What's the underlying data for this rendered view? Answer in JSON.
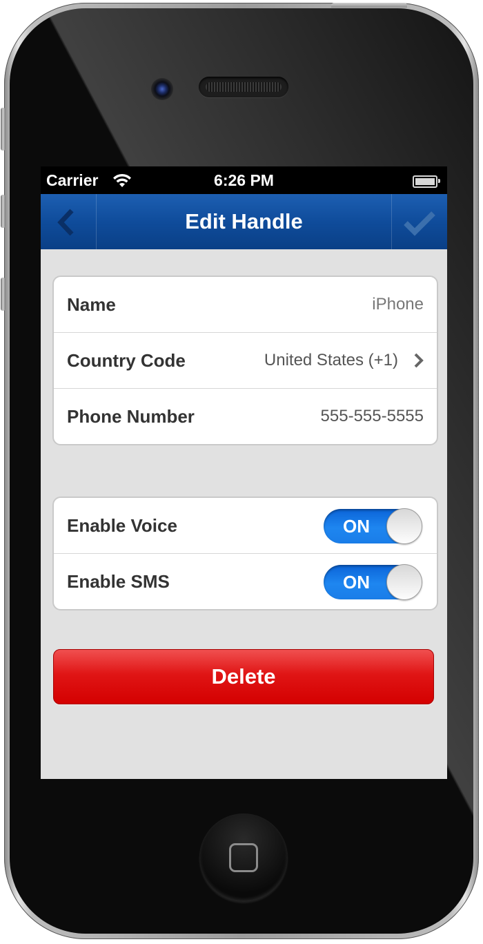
{
  "status_bar": {
    "carrier": "Carrier",
    "time": "6:26 PM",
    "wifi_icon": "wifi-icon",
    "battery_icon": "battery-icon"
  },
  "nav_bar": {
    "title": "Edit Handle",
    "back_icon": "chevron-left-icon",
    "done_icon": "checkmark-icon",
    "color": "#0f4c9b"
  },
  "handle_group": {
    "rows": [
      {
        "label": "Name",
        "value": "iPhone"
      },
      {
        "label": "Country Code",
        "value": "United States (+1)",
        "icon": "chevron-right-icon"
      },
      {
        "label": "Phone Number",
        "value": "555-555-5555"
      }
    ]
  },
  "settings_group": {
    "rows": [
      {
        "label": "Enable Voice",
        "toggle": "ON"
      },
      {
        "label": "Enable SMS",
        "toggle": "ON"
      }
    ],
    "toggle_color": "#1a7de8"
  },
  "delete_button": {
    "label": "Delete",
    "color": "#e01515"
  },
  "device": {
    "home_button_icon": "home-button-icon"
  }
}
